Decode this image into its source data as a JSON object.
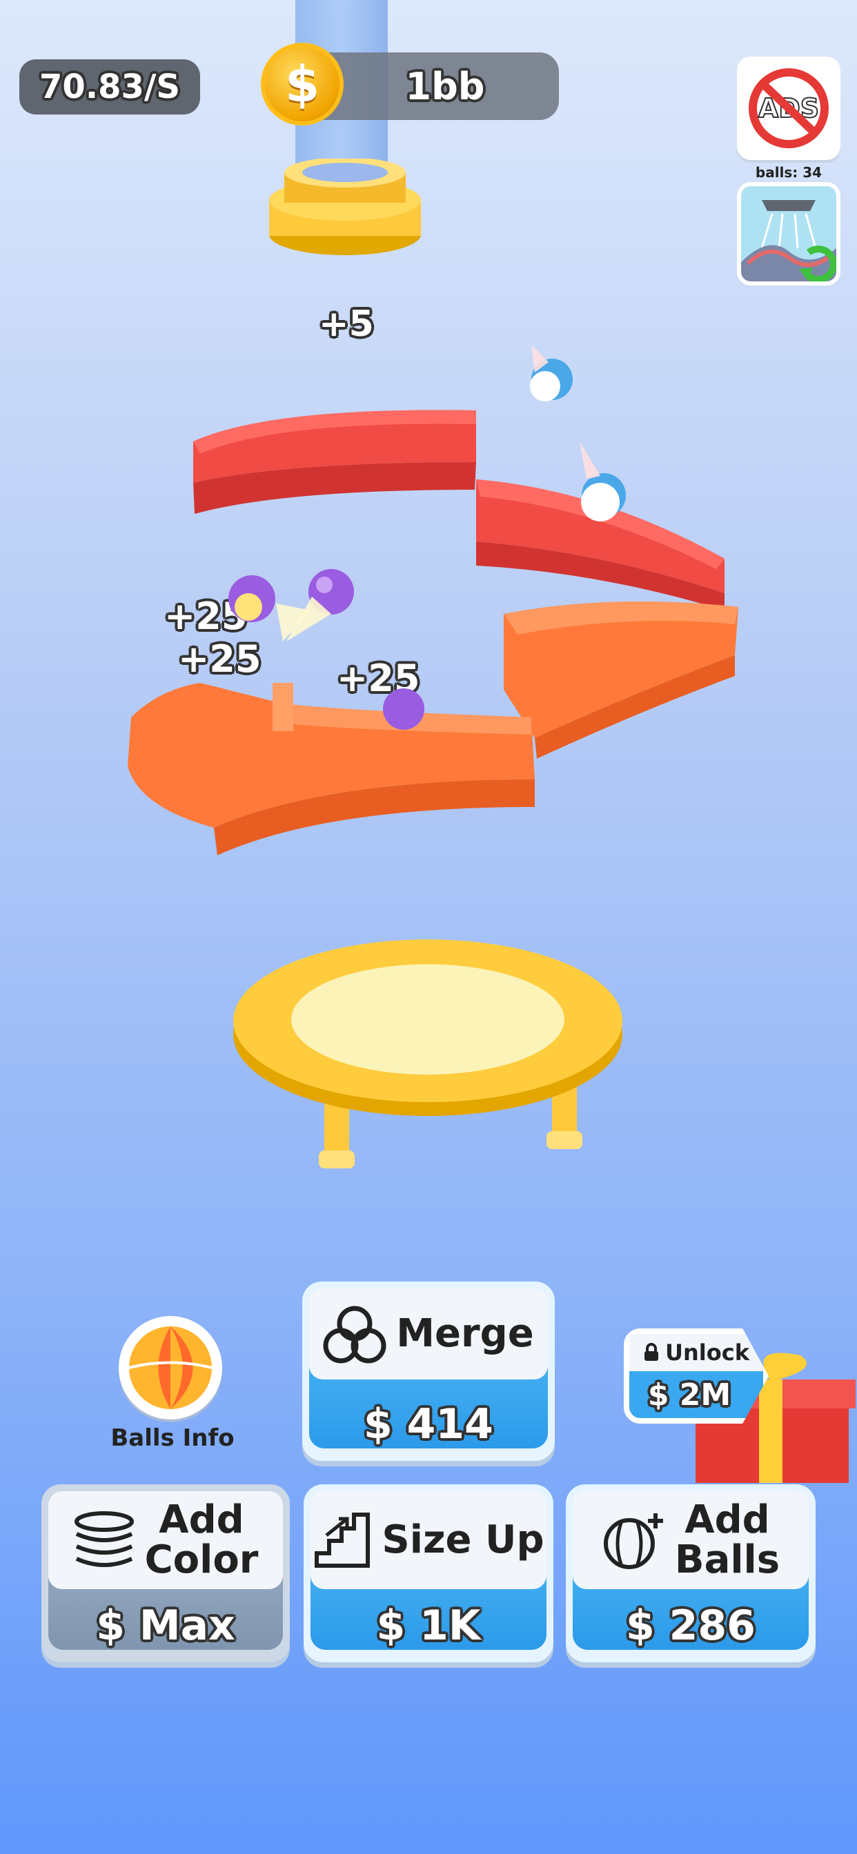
{
  "hud": {
    "income_rate": "70.83/S",
    "coins": "1bb",
    "no_ads_label": "ADS",
    "balls_count": "balls: 34"
  },
  "scene": {
    "popups": [
      "+5",
      "+25",
      "+25",
      "+25"
    ]
  },
  "balls_info": {
    "label": "Balls Info"
  },
  "unlock": {
    "label": "Unlock",
    "price": "$ 2M"
  },
  "buttons": {
    "merge": {
      "label": "Merge",
      "price": "$ 414"
    },
    "add_color": {
      "label_line1": "Add",
      "label_line2": "Color",
      "price": "$ Max"
    },
    "size_up": {
      "label": "Size Up",
      "price": "$ 1K"
    },
    "add_balls": {
      "label_line1": "Add",
      "label_line2": "Balls",
      "price": "$ 286"
    }
  },
  "colors": {
    "red_track": "#f04b44",
    "orange_track": "#ff7a3a",
    "trampoline": "#ffc93c",
    "button_blue": "#3aa8f0"
  }
}
